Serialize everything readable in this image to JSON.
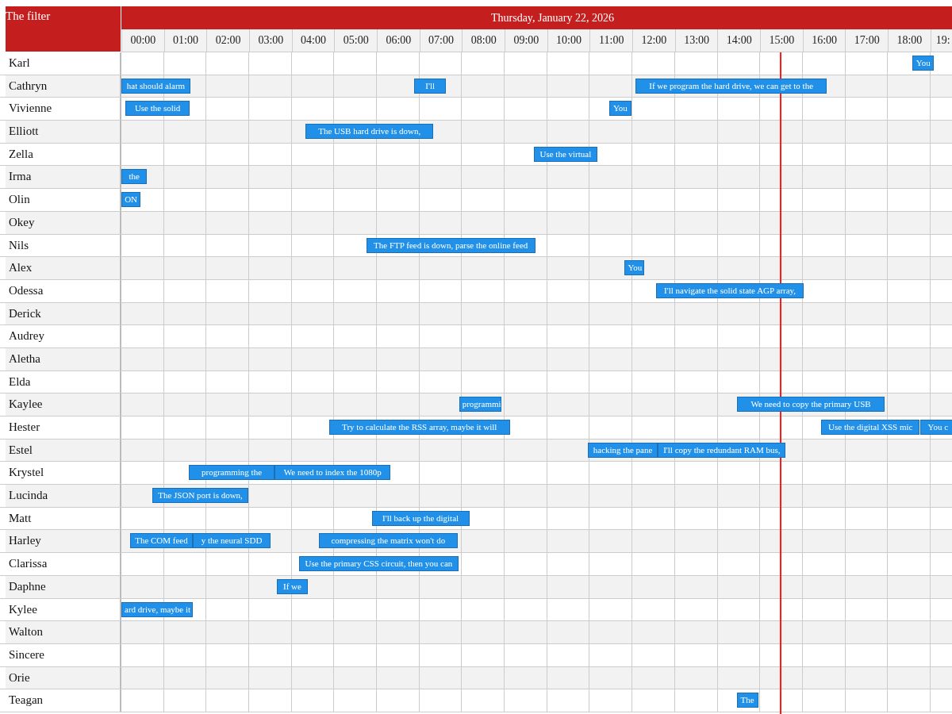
{
  "filter_label": "The filter",
  "date": "Thursday, January 22, 2026",
  "hours": [
    "00:00",
    "01:00",
    "02:00",
    "03:00",
    "04:00",
    "05:00",
    "06:00",
    "07:00",
    "08:00",
    "09:00",
    "10:00",
    "11:00",
    "12:00",
    "13:00",
    "14:00",
    "15:00",
    "16:00",
    "17:00",
    "18:00",
    "19:"
  ],
  "rows": [
    {
      "name": "Karl",
      "events": [
        {
          "text": "You"
        }
      ]
    },
    {
      "name": "Cathryn",
      "events": [
        {
          "text": "hat should alarm"
        },
        {
          "text": "I'll"
        },
        {
          "text": "If we program the hard drive, we can get to the"
        }
      ]
    },
    {
      "name": "Vivienne",
      "events": [
        {
          "text": "Use the solid"
        },
        {
          "text": "You"
        }
      ]
    },
    {
      "name": "Elliott",
      "events": [
        {
          "text": "The USB hard drive is down,"
        }
      ]
    },
    {
      "name": "Zella",
      "events": [
        {
          "text": "Use the virtual"
        }
      ]
    },
    {
      "name": "Irma",
      "events": [
        {
          "text": "the"
        }
      ]
    },
    {
      "name": "Olin",
      "events": [
        {
          "text": "ON"
        }
      ]
    },
    {
      "name": "Okey",
      "events": []
    },
    {
      "name": "Nils",
      "events": [
        {
          "text": "The FTP feed is down, parse the online feed"
        }
      ]
    },
    {
      "name": "Alex",
      "events": [
        {
          "text": "You"
        }
      ]
    },
    {
      "name": "Odessa",
      "events": [
        {
          "text": "I'll navigate the solid state AGP array,"
        }
      ]
    },
    {
      "name": "Derick",
      "events": []
    },
    {
      "name": "Audrey",
      "events": []
    },
    {
      "name": "Aletha",
      "events": []
    },
    {
      "name": "Elda",
      "events": []
    },
    {
      "name": "Kaylee",
      "events": [
        {
          "text": "programmi"
        },
        {
          "text": "We need to copy the primary USB"
        }
      ]
    },
    {
      "name": "Hester",
      "events": [
        {
          "text": "Try to calculate the RSS array, maybe it will"
        },
        {
          "text": "Use the digital XSS mic"
        },
        {
          "text": "You c"
        }
      ]
    },
    {
      "name": "Estel",
      "events": [
        {
          "text": "hacking the pane"
        },
        {
          "text": "I'll copy the redundant RAM bus,"
        }
      ]
    },
    {
      "name": "Krystel",
      "events": [
        {
          "text": "programming the"
        },
        {
          "text": "We need to index the 1080p"
        }
      ]
    },
    {
      "name": "Lucinda",
      "events": [
        {
          "text": "The JSON port is down,"
        }
      ]
    },
    {
      "name": "Matt",
      "events": [
        {
          "text": "I'll back up the digital"
        }
      ]
    },
    {
      "name": "Harley",
      "events": [
        {
          "text": "The COM feed"
        },
        {
          "text": "y the neural SDD"
        },
        {
          "text": "compressing the matrix won't do"
        }
      ]
    },
    {
      "name": "Clarissa",
      "events": [
        {
          "text": "Use the primary CSS circuit, then you can"
        }
      ]
    },
    {
      "name": "Daphne",
      "events": [
        {
          "text": "If we"
        }
      ]
    },
    {
      "name": "Kylee",
      "events": [
        {
          "text": "ard drive, maybe it"
        }
      ]
    },
    {
      "name": "Walton",
      "events": []
    },
    {
      "name": "Sincere",
      "events": []
    },
    {
      "name": "Orie",
      "events": []
    },
    {
      "name": "Teagan",
      "events": [
        {
          "text": "The"
        }
      ]
    }
  ]
}
